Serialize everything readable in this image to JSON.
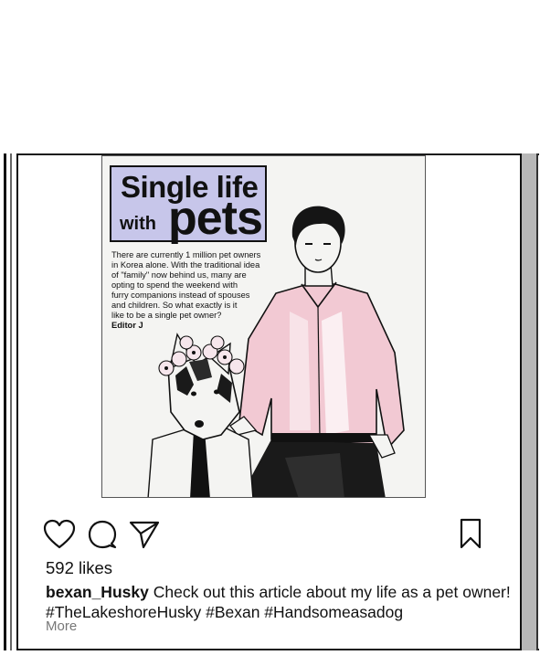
{
  "post": {
    "image": {
      "title_line1": "Single life",
      "title_with": "with",
      "title_pets": "pets",
      "body_lines": [
        "There are currently 1 million pet owners",
        "in Korea alone. With the traditional idea",
        "of \"family\" now behind us, many are",
        "opting to spend the weekend with",
        "furry companions instead of spouses",
        "and children. So what exactly is it",
        "like to be a single pet owner?"
      ],
      "editor": "Editor J"
    },
    "actions": {
      "like_icon": "heart-icon",
      "comment_icon": "comment-icon",
      "share_icon": "send-icon",
      "save_icon": "bookmark-icon"
    },
    "likes": "592 likes",
    "caption": {
      "username": "bexan_Husky",
      "text": "Check out this article about my life as a pet owner!",
      "hashtags": "#TheLakeshoreHusky #Bexan #Handsomeasadog"
    },
    "more_label": "More"
  },
  "colors": {
    "title_box": "#c7c6ea",
    "shirt_pink": "#f2c9d3",
    "ink": "#111111",
    "frame_gray": "#b8b8b8"
  }
}
